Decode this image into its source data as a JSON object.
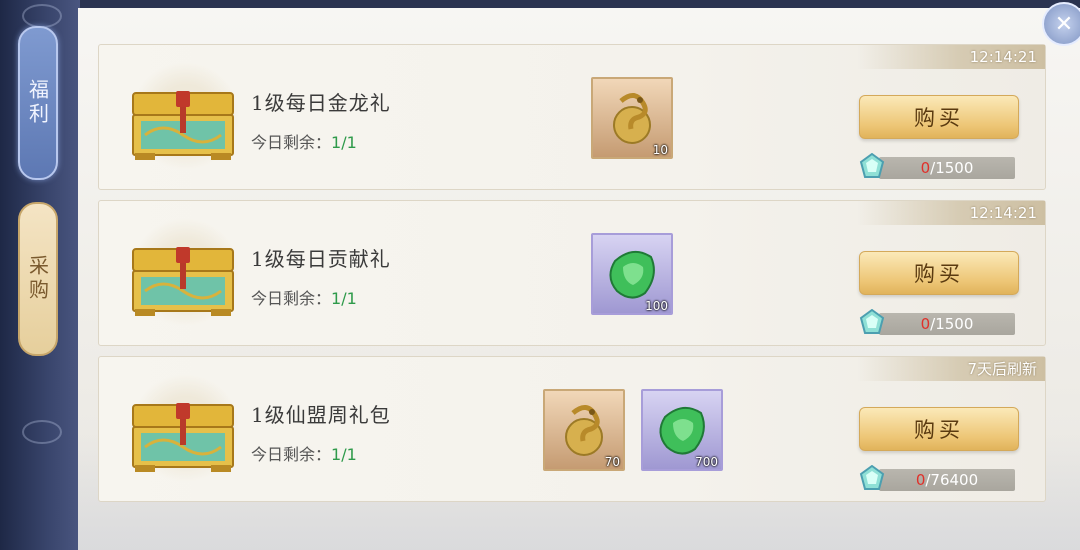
{
  "sidebar": {
    "tabs": [
      {
        "label": "福利",
        "active": true
      },
      {
        "label": "采购",
        "active": false
      }
    ]
  },
  "close_icon": "close-icon",
  "colors": {
    "remaining_count": "#2e9a4a",
    "cost_current": "#e0302a",
    "buy_button": "#edc676"
  },
  "packs": [
    {
      "refresh": "12:14:21",
      "title": "1级每日金龙礼",
      "remaining_label": "今日剩余：",
      "remaining_value": "1/1",
      "items": [
        {
          "icon": "gold-dragon-icon",
          "qty": "10"
        }
      ],
      "buy_label": "购买",
      "cost_current": "0",
      "cost_total": "/1500"
    },
    {
      "refresh": "12:14:21",
      "title": "1级每日贡献礼",
      "remaining_label": "今日剩余：",
      "remaining_value": "1/1",
      "items": [
        {
          "icon": "jade-token-icon",
          "qty": "100"
        }
      ],
      "buy_label": "购买",
      "cost_current": "0",
      "cost_total": "/1500"
    },
    {
      "refresh": "7天后刷新",
      "title": "1级仙盟周礼包",
      "remaining_label": "今日剩余：",
      "remaining_value": "1/1",
      "items": [
        {
          "icon": "gold-dragon-icon",
          "qty": "70"
        },
        {
          "icon": "jade-token-icon",
          "qty": "700"
        }
      ],
      "buy_label": "购买",
      "cost_current": "0",
      "cost_total": "/76400"
    }
  ]
}
